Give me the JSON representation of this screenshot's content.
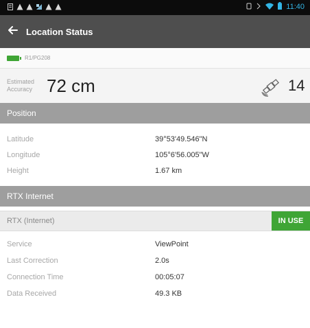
{
  "status_bar": {
    "left_icons": [
      "notification-icon",
      "warning-icon",
      "warning-icon",
      "app-notification-icon",
      "warning-icon",
      "warning-icon"
    ],
    "right_icons": [
      "alarm-icon",
      "vibrate-icon",
      "wifi-icon",
      "battery-icon"
    ],
    "time": "11:40"
  },
  "app_bar": {
    "back_icon": "arrow-left-icon",
    "title": "Location Status"
  },
  "device": {
    "id": "R1/PG208",
    "battery_color": "#3fa535"
  },
  "accuracy": {
    "label": "Estimated Accuracy",
    "value": "72 cm",
    "satellite_icon": "satellite-icon",
    "satellite_count": "14"
  },
  "position": {
    "section_title": "Position",
    "rows": [
      {
        "label": "Latitude",
        "value": "39°53'49.546\"N"
      },
      {
        "label": "Longitude",
        "value": "105°6'56.005\"W"
      },
      {
        "label": "Height",
        "value": "1.67 km"
      }
    ]
  },
  "rtx": {
    "section_title": "RTX Internet",
    "source_label": "RTX (Internet)",
    "status": "IN USE",
    "status_color": "#3fa535",
    "rows": [
      {
        "label": "Service",
        "value": "ViewPoint"
      },
      {
        "label": "Last Correction",
        "value": "2.0s"
      },
      {
        "label": "Connection Time",
        "value": "00:05:07"
      },
      {
        "label": "Data Received",
        "value": "49.3 KB"
      }
    ]
  }
}
